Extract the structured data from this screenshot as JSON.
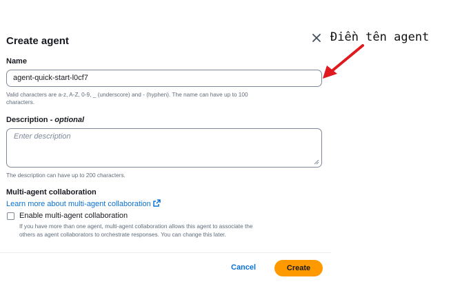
{
  "dialog": {
    "title": "Create agent",
    "close_icon": "close-icon"
  },
  "name_field": {
    "label": "Name",
    "value": "agent-quick-start-l0cf7",
    "hint_line1": "Valid characters are a-z, A-Z, 0-9, _ (underscore) and - (hyphen). The name can have up to 100",
    "hint_line2": "characters."
  },
  "description_field": {
    "label_main": "Description - ",
    "label_optional": "optional",
    "placeholder": "Enter description",
    "hint": "The description can have up to 200 characters."
  },
  "multi_agent": {
    "heading": "Multi-agent collaboration",
    "learn_more": "Learn more about multi-agent collaboration",
    "external_icon": "external-link-icon",
    "checkbox_label": "Enable multi-agent collaboration",
    "checkbox_checked": false,
    "checkbox_desc_line1": "If you have more than one agent, multi-agent collaboration allows this agent to associate the",
    "checkbox_desc_line2": "others as agent collaborators to orchestrate responses. You can change this later."
  },
  "footer": {
    "cancel_label": "Cancel",
    "create_label": "Create",
    "create_color": "#ff9900",
    "link_color": "#0972d3"
  },
  "annotation": {
    "text": "Điền tên agent",
    "arrow_color": "#e0191f"
  }
}
